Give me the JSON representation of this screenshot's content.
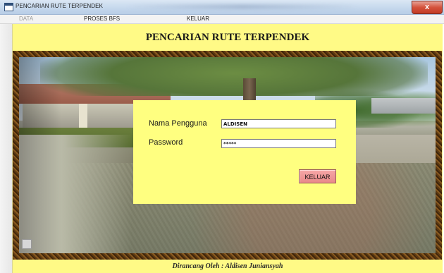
{
  "window": {
    "title": "PENCARIAN RUTE TERPENDEK",
    "close_label": "x"
  },
  "menu": {
    "items": [
      {
        "label": "DATA",
        "enabled": false
      },
      {
        "label": "PROSES BFS",
        "enabled": true
      },
      {
        "label": "KELUAR",
        "enabled": true
      }
    ]
  },
  "header": {
    "title": "PENCARIAN RUTE TERPENDEK"
  },
  "login": {
    "username_label": "Nama Pengguna",
    "username_value": "ALDISEN",
    "password_label": "Password",
    "password_value": "*****",
    "exit_button": "KELUAR"
  },
  "footer": {
    "credit": "Dirancang Oleh  :  Aldisen Juniansyah"
  },
  "colors": {
    "panel_bg": "#fffa86",
    "login_bg": "#ffff80",
    "button_bg": "#f0a0a0",
    "frame": "#6b4418"
  },
  "icons": {
    "app": "window-app-icon",
    "close": "close-icon"
  }
}
